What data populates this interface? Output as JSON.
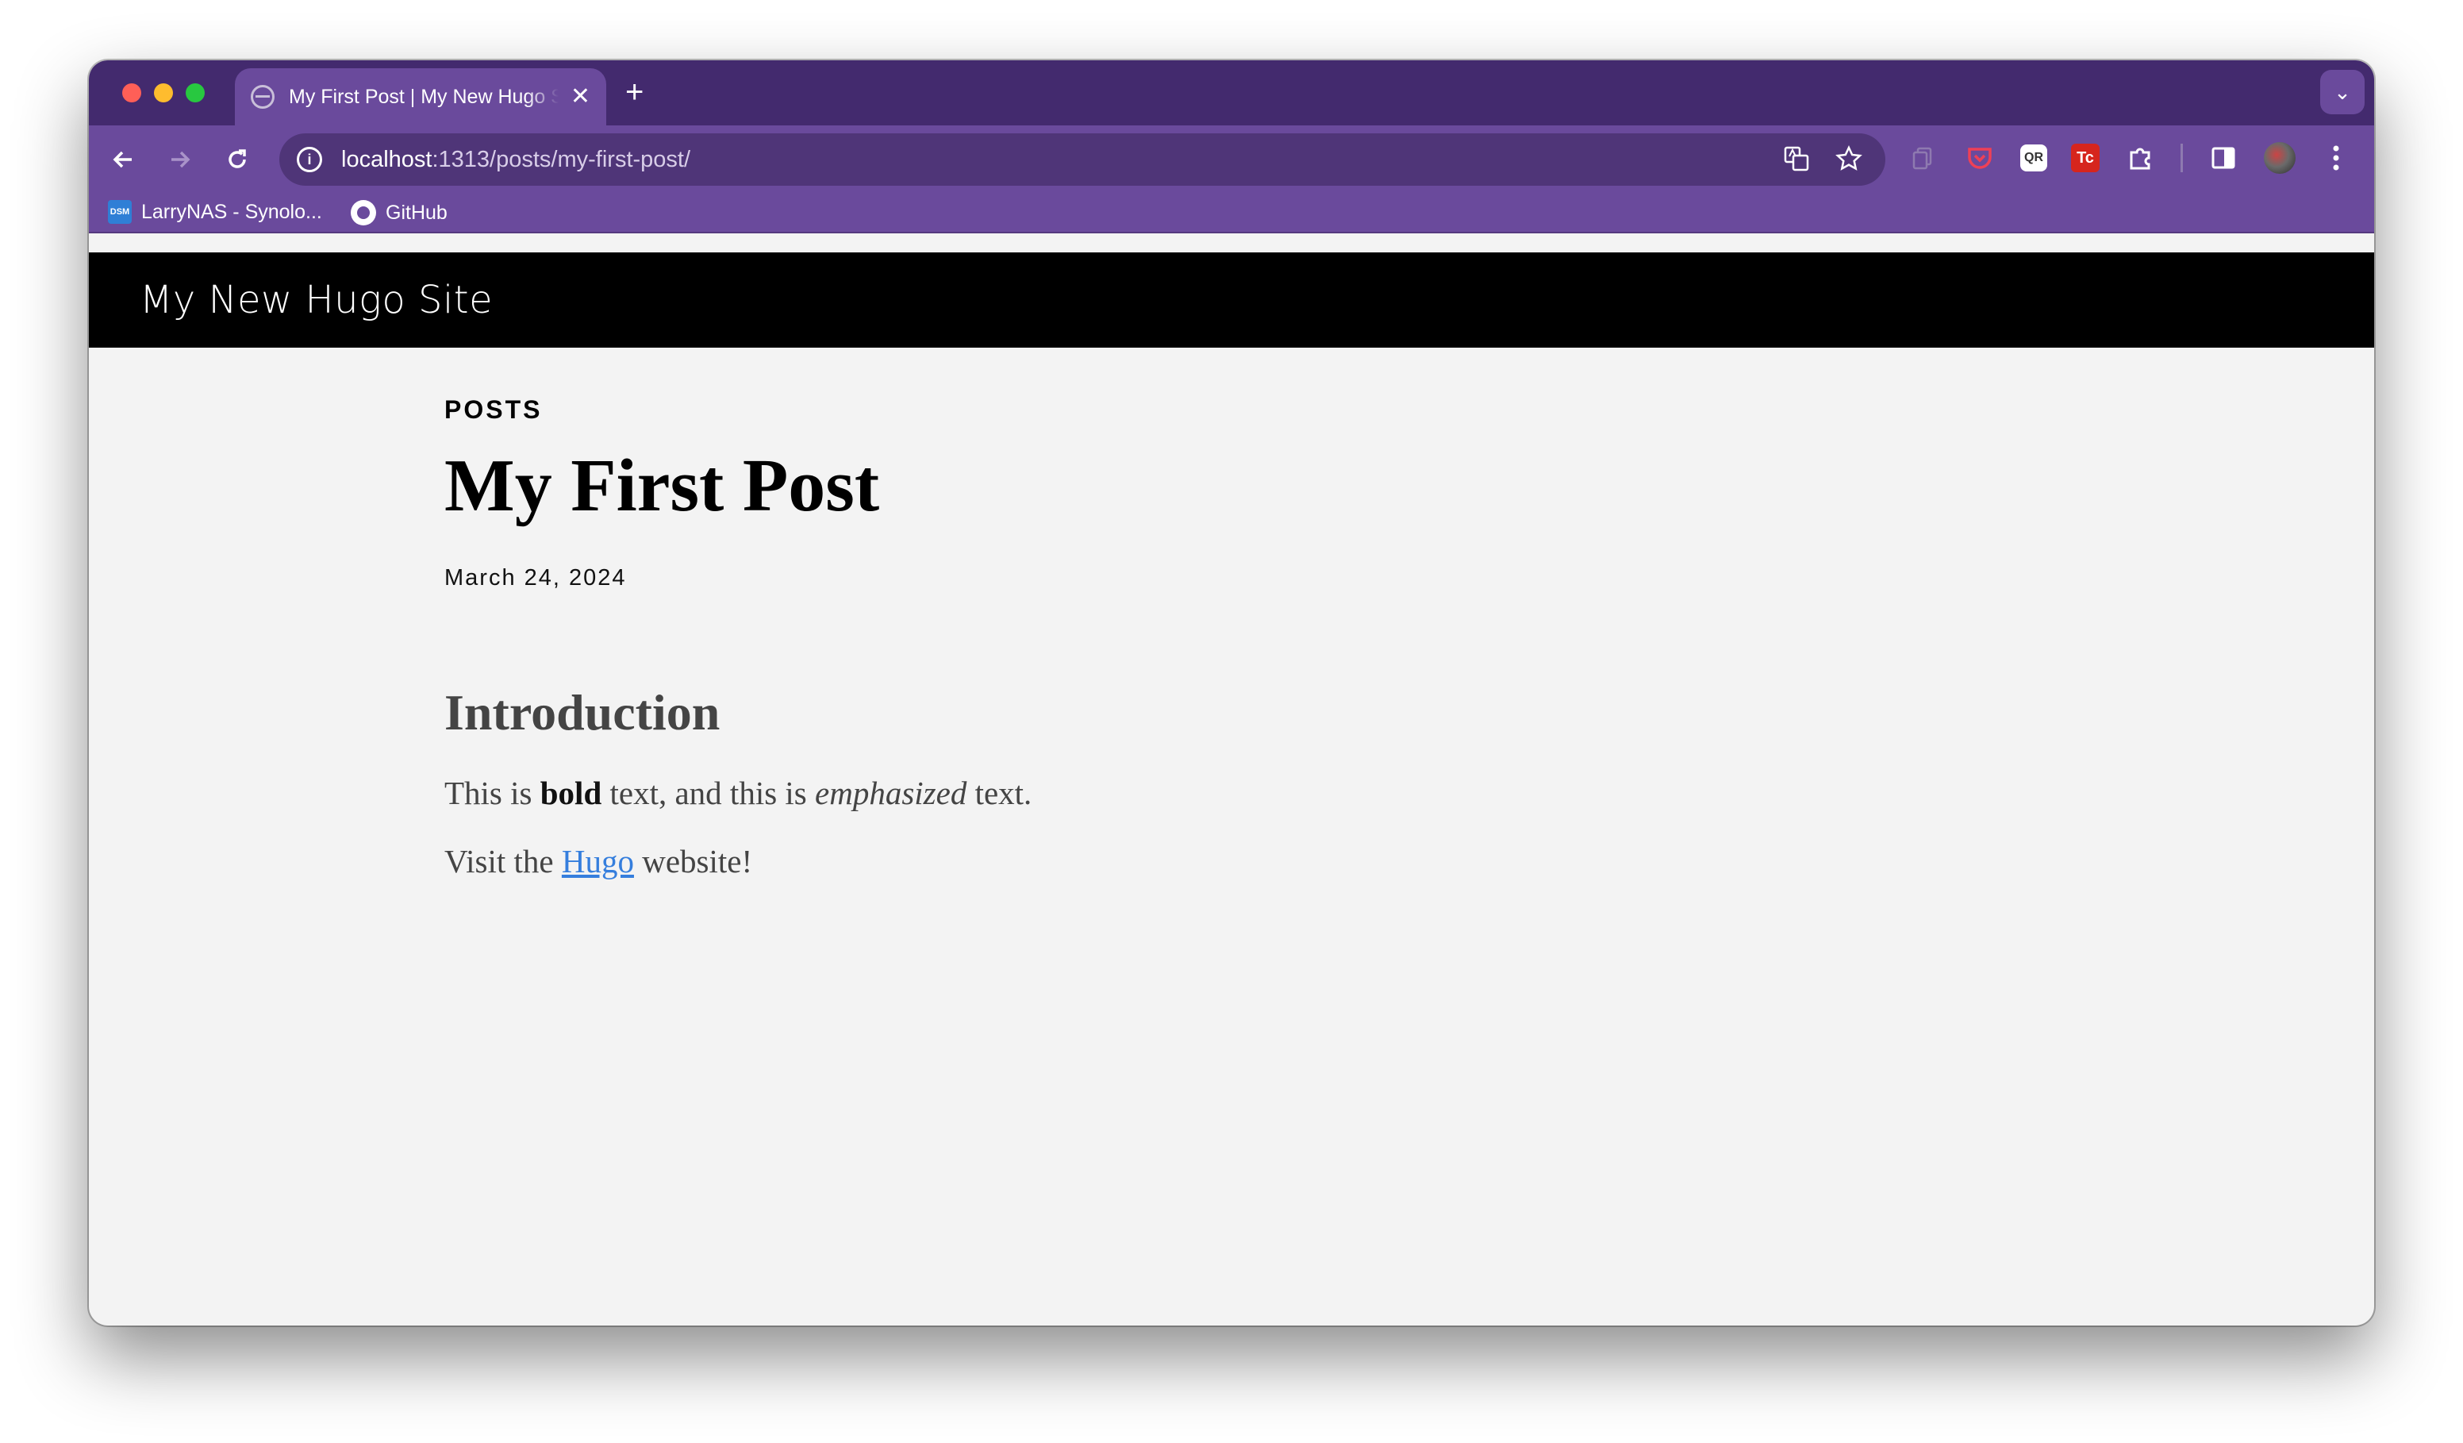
{
  "browser": {
    "tab": {
      "title": "My First Post | My New Hugo Site",
      "close_label": "✕"
    },
    "new_tab_label": "+",
    "tab_search_label": "⌄",
    "address": {
      "host": "localhost",
      "path": ":1313/posts/my-first-post/"
    },
    "bookmarks": [
      {
        "label": "LarryNAS - Synolo...",
        "icon": "dsm-icon",
        "icon_text": "DSM"
      },
      {
        "label": "GitHub",
        "icon": "github-icon"
      }
    ],
    "extensions": {
      "qr_text": "QR",
      "tex_text": "Tc"
    }
  },
  "site": {
    "title": "My New Hugo Site"
  },
  "post": {
    "section": "POSTS",
    "title": "My First Post",
    "date": "March 24, 2024",
    "heading": "Introduction",
    "p1": {
      "pre": "This is ",
      "bold": "bold",
      "mid": " text, and this is ",
      "em": "emphasized",
      "post": " text."
    },
    "p2": {
      "pre": "Visit the ",
      "link": "Hugo",
      "post": " website!"
    }
  },
  "colors": {
    "tabstrip": "#432a6e",
    "toolbar": "#6a4a9c",
    "header": "#000000",
    "page_bg": "#f3f3f3",
    "link": "#357edd"
  }
}
